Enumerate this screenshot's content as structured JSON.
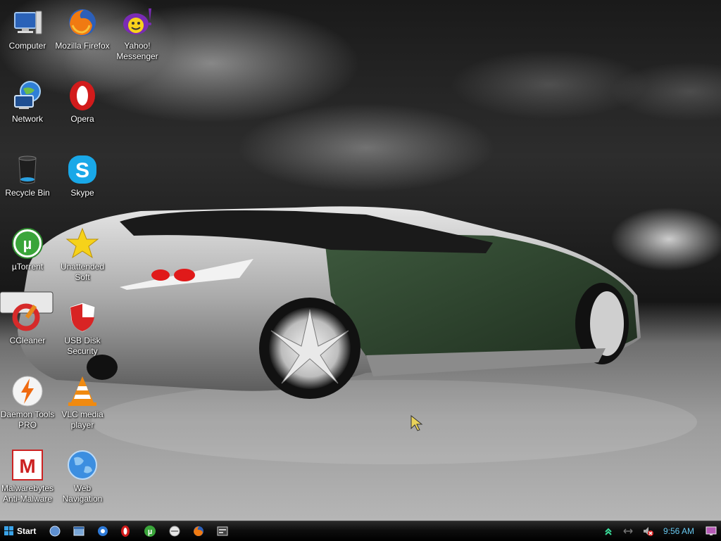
{
  "desktop": {
    "icons": [
      {
        "label": "Computer"
      },
      {
        "label": "Mozilla Firefox"
      },
      {
        "label": "Yahoo! Messenger"
      },
      {
        "label": "Network"
      },
      {
        "label": "Opera"
      },
      {
        "label": "Recycle Bin"
      },
      {
        "label": "Skype"
      },
      {
        "label": "µTorrent"
      },
      {
        "label": "Unattended Soft"
      },
      {
        "label": "CCleaner"
      },
      {
        "label": "USB Disk Security"
      },
      {
        "label": "Daemon Tools PRO"
      },
      {
        "label": "VLC media player"
      },
      {
        "label": "Malwarebytes Anti-Malware"
      },
      {
        "label": "Web Navigation"
      }
    ]
  },
  "taskbar": {
    "start_label": "Start",
    "clock": "9:56 AM"
  },
  "colors": {
    "clock": "#67c8f0",
    "taskbar": "#000000"
  }
}
